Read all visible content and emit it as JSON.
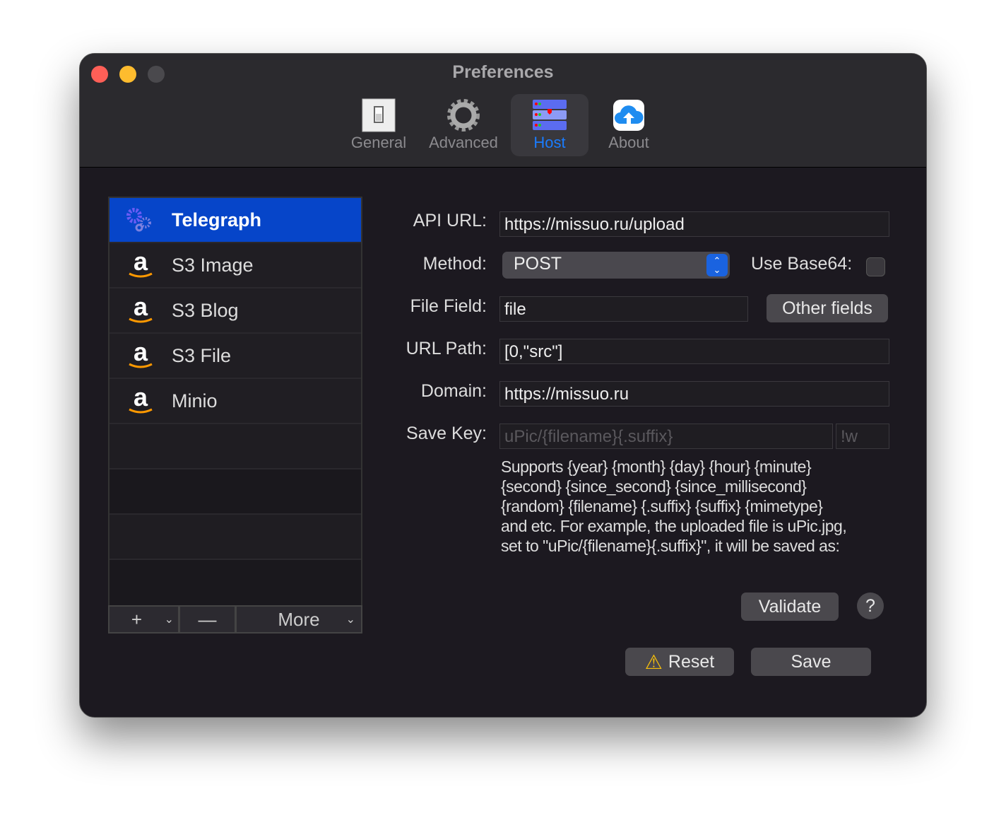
{
  "window": {
    "title": "Preferences"
  },
  "toolbar": {
    "tabs": [
      {
        "label": "General",
        "icon": "switch-icon"
      },
      {
        "label": "Advanced",
        "icon": "gear-icon"
      },
      {
        "label": "Host",
        "icon": "server-icon",
        "active": true
      },
      {
        "label": "About",
        "icon": "cloud-upload-icon"
      }
    ]
  },
  "sidebar": {
    "items": [
      {
        "label": "Telegraph",
        "icon": "gears-icon",
        "selected": true
      },
      {
        "label": "S3 Image",
        "icon": "amazon-icon"
      },
      {
        "label": "S3 Blog",
        "icon": "amazon-icon"
      },
      {
        "label": "S3 File",
        "icon": "amazon-icon"
      },
      {
        "label": "Minio",
        "icon": "amazon-icon"
      }
    ],
    "add": "+",
    "remove": "—",
    "more": "More"
  },
  "form": {
    "api_url_label": "API URL:",
    "api_url": "https://missuo.ru/upload",
    "method_label": "Method:",
    "method": "POST",
    "base64_label": "Use Base64:",
    "base64": false,
    "file_field_label": "File Field:",
    "file_field": "file",
    "other_fields": "Other fields",
    "url_path_label": "URL Path:",
    "url_path": "[0,\"src\"]",
    "domain_label": "Domain:",
    "domain": "https://missuo.ru",
    "save_key_label": "Save Key:",
    "save_key_placeholder": "uPic/{filename}{.suffix}",
    "save_key_suffix_placeholder": "!w",
    "help_lines": [
      "Supports {year} {month} {day} {hour} {minute}",
      "{second} {since_second} {since_millisecond}",
      "{random} {filename} {.suffix} {suffix} {mimetype}",
      "and etc. For example, the uploaded file is uPic.jpg,",
      "set to \"uPic/{filename}{.suffix}\", it will be saved as:"
    ],
    "validate": "Validate",
    "help": "?",
    "reset": "Reset",
    "save": "Save"
  },
  "colors": {
    "accent": "#0645c9",
    "host_tab": "#1a7cff"
  }
}
